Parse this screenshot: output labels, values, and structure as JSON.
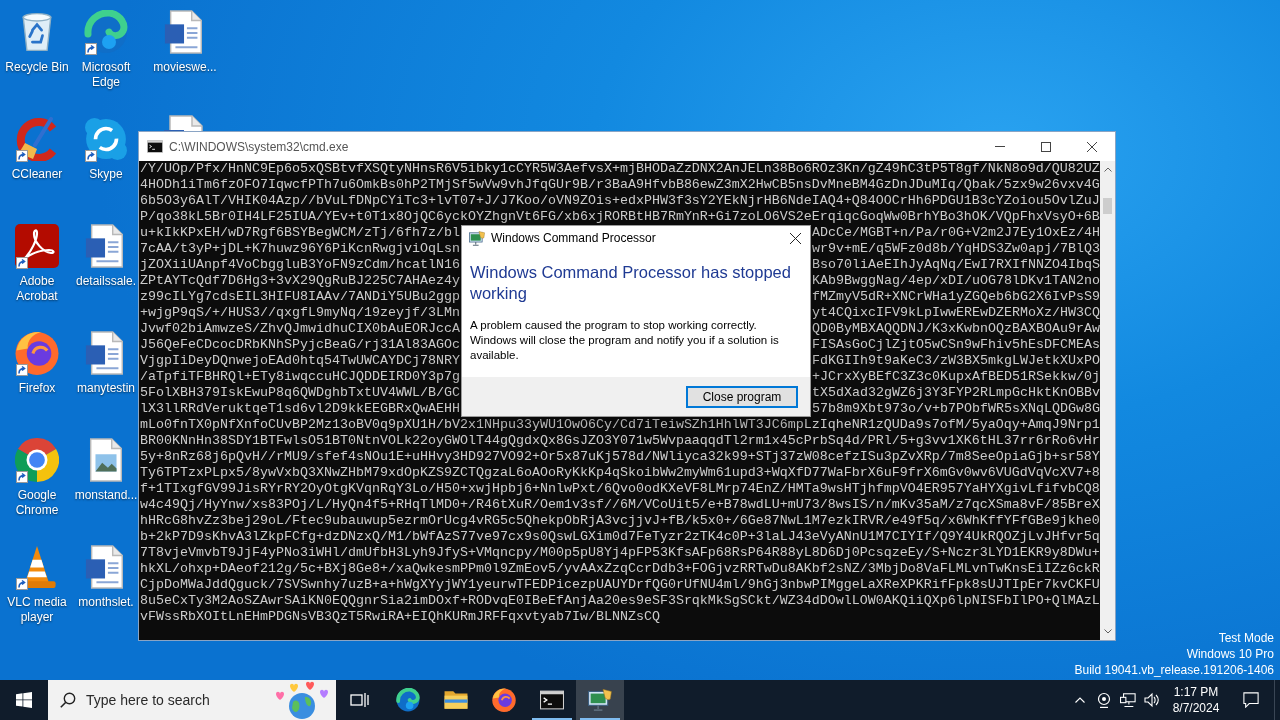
{
  "desktop": {
    "icon_columns": [
      {
        "icons": [
          {
            "label": "Recycle Bin",
            "kind": "recycle-bin",
            "shortcut": false
          },
          {
            "label": "CCleaner",
            "kind": "ring-brush",
            "shortcut": true
          },
          {
            "label": "Adobe Acrobat",
            "kind": "tile-logo",
            "shortcut": true
          },
          {
            "label": "Firefox",
            "kind": "fox-globe",
            "shortcut": true
          },
          {
            "label": "Google Chrome",
            "kind": "segmented-ring",
            "shortcut": true
          },
          {
            "label": "VLC media player",
            "kind": "cone",
            "shortcut": true
          }
        ]
      },
      {
        "icons": [
          {
            "label": "Microsoft Edge",
            "kind": "swirl",
            "shortcut": true
          },
          {
            "label": "Skype",
            "kind": "circle-logo",
            "shortcut": true
          },
          {
            "label": "detailssale.",
            "kind": "document",
            "shortcut": false
          },
          {
            "label": "manytestin",
            "kind": "document",
            "shortcut": false
          },
          {
            "label": "monstand...",
            "kind": "image-file",
            "shortcut": false
          },
          {
            "label": "monthslet.",
            "kind": "document",
            "shortcut": false
          }
        ]
      },
      {
        "icons": [
          {
            "label": "movieswe...",
            "kind": "document",
            "shortcut": false
          },
          {
            "kind": "document",
            "shortcut": false
          }
        ]
      }
    ],
    "system_info": [
      "Test Mode",
      "Windows 10 Pro",
      "Build 19041.vb_release.191206-1406"
    ]
  },
  "console_window": {
    "title": "C:\\WINDOWS\\system32\\cmd.exe",
    "lines": [
      {
        "kind": "full",
        "text": "/Y/UOp/Pfx/HnNC9Ep6o5xQSBtvfXSQtyNHnsR6V5ibky1cCYR5W3AefvsX+mjBHODaZzDNX2AnJELn38Bo6ROz3Kn/gZ49hC3tP5T8gf/NkN8o9d/QU82UZ"
      },
      {
        "kind": "full",
        "text": "4HODh1iTm6fzOFO7IqwcfPTh7u6OmkBs0hP2TMjSf5wVw9vhJfqGUr9B/r3BaA9HfvbB86ewZ3mX2HwCB5nsDvMneBM4GzDnJDuMIq/Qbak/5zx9w26vxv4G"
      },
      {
        "kind": "full",
        "text": "6b5O3y6AlT/VHIK04Azp//bVuLfDNpCYiTc3+lvT07+J/J7Koo/oVN9ZOis+edxPHW3f3sY2YEkNjrHB6NdeIAQ4+Q84OOCrHh6PDGU1B3cYZoiou5OvlZuJ"
      },
      {
        "kind": "full",
        "text": "P/qo38kL5Br0IH4LF25IUA/YEv+t0T1x8OjQC6yckOYZhgnVt6FG/xb6xjRORBtHB7RmYnR+Gi7zoLO6VS2eErqiqcGoqWw0BrhYBo3hOK/VQpFhxVsyO+6B"
      },
      {
        "kind": "split",
        "left": "u+kIkKPxEH/wD7Rgf6BSYBegWCM/zTj/6fh7z/bl",
        "right": "ADcCe/MGBT+n/Pa/r0G+V2m2J7Ey1OxEz/4H"
      },
      {
        "kind": "split",
        "left": "7cAA/t3yP+jDL+K7huwz96Y6PiKcnRwgjviOqLsn",
        "right": "wr9v+mE/q5WFz0d8b/YqHDS3Zw0apj/7BlQ3"
      },
      {
        "kind": "split",
        "left": "jZOXiiUAnpf4VoCbggluB3YoFN9zCdm/hcatlN16",
        "right": "Bso70liAeEIhJyAqNq/EwI7RXIfNNZO4IbqS"
      },
      {
        "kind": "split",
        "left": "ZPtAYTcQdf7D6Hg3+3vX29QgRuBJ225C7AHAez4y",
        "right": "KAb9BwggNag/4ep/xDI/uOG78lDKv1TAN2no"
      },
      {
        "kind": "split",
        "left": "z99cILYg7cdsEIL3HIFU8IAAv/7ANDiY5UBu2ggp",
        "right": "fMZmyV5dR+XNCrWHa1yZGQeb6bG2X6IvPsS9"
      },
      {
        "kind": "split",
        "left": "+wjgP9qS/+/HUS3//qxgfL9myNq/19zeyjf/3LMn",
        "right": "yt4CQixcIFV9kLpIwwEREwDZERMoXz/HW3CQ"
      },
      {
        "kind": "split",
        "left": "Jvwf02biAmwzeS/ZhvQJmwidhuCIX0bAuEORJccA",
        "right": "QD0ByMBXAQQDNJ/K3xKwbnOQzBAXBOAu9rAw"
      },
      {
        "kind": "split",
        "left": "J56QeFeCDcocDRbKNhSPyjcBeaG/rj31Al83AGOc",
        "right": "FISAsGoCjlZjtO5wCSn9wFhiv5hEsDFCMEAs"
      },
      {
        "kind": "split",
        "left": "VjgpIiDeyDQnwejoEAd0htq54TwUWCAYDCj78NRY",
        "right": "FdKGIIh9t9aKeC3/zW3BX5mkgLWJetkXUxPO"
      },
      {
        "kind": "split",
        "left": "/aTpfiTFBHRQl+ETy8iwqccuHCJQDDEIRD0Y3p7g",
        "right": "+JCrxXyBEfC3Z3c0KupxAfBED51RSekkw/0j"
      },
      {
        "kind": "split",
        "left": "5FolXBH379IskEwuP8q6QWDghbTxtUV4WWL/B/GC",
        "right": "tX5dXad32gWZ6j3Y3FYP2RLmpGcHktKnOBBv"
      },
      {
        "kind": "split",
        "left": "lX3llRRdVeruktqeT1sd6vl2D9kkEEGBRxQwAEHH",
        "right": "57b8m9Xbt973o/v+b7PObfWR5sXNqLQDGw8G"
      },
      {
        "kind": "full",
        "text": "mLo0fnTX0pNfXnfoCUvBP2Mz13oBV0q9pXU1H/bV2x1NHpu33yWU1OwO6Cy/Cd7iTeiwSZh1HhlWT3JC6mpLzIqheNR1zQUDa9s7ofM/5yaOqy+AmqJ9Nrp1"
      },
      {
        "kind": "full",
        "text": "BR00KNnHn38SDY1BTFwlsO51BT0NtnVOLk22oyGWOlT44gQgdxQx8GsJZO3Y071w5WvpaaqqdTl2rm1x45cPrbSq4d/PRl/5+g3vv1XK6tHL37rr6rRo6vHr"
      },
      {
        "kind": "full",
        "text": "5y+8nRz68j6pQvH//rMU9/sfef4sNOu1E+uHHvy3HD927VO92+Or5x87uKj578d/NWliyca32k99+STj37zW08cefzISu3pZvXRp/7m8SeeOpiaGjb+sr58Y"
      },
      {
        "kind": "full",
        "text": "Ty6TPTzxPLpx5/8ywVxbQ3XNwZHbM79xdOpKZS9ZCTQgzaL6oAOoRyKkKp4qSkoibWw2myWm61upd3+WqXfD77WaFbrX6uF9frX6mGv0wv6VUGdVqVcXV7+8"
      },
      {
        "kind": "full",
        "text": "f+1TIxgfGV99JisRYrRY2OyOtgKVqnRqY3Lo/H50+xwjHpbj6+NnlwPxt/6Qvo0odKXeVF8LMrp74EnZ/HMTa9wsHTjhfmpVO4ER957YaHYXgivLfifvbCQ8"
      },
      {
        "kind": "full",
        "text": "w4c49Qj/HyYnw/xs83POj/L/HyQn4f5+RHqTlMD0+/R46tXuR/Oem1v3sf//6M/VCoUit5/e+B78wdLU+mU73/8wsIS/n/mKv35aM/z7qcXSma8vF/85BreX"
      },
      {
        "kind": "full",
        "text": "hHRcG8hvZz3bej29oL/Ftec9ubauwup5ezrmOrUcg4vRG5c5QhekpObRjA3vcjjvJ+fB/k5x0+/6Ge87NwL1M7ezkIRVR/e49f5q/x6WhKffYFfGBe9jkhe0"
      },
      {
        "kind": "full",
        "text": "b+2kP7D9sKhvA3lZkpFCfg+dzDNzxQ/M1/bWfAzS77ve97cx9s0QswLGXim0d7FeTyzr2zTK4c0P+3laLJ43eVyANnU1M7CIYIf/Q9Y4UkRQOZjLvJHfvr5q"
      },
      {
        "kind": "full",
        "text": "7T8vjeVmvbT9JjF4yPNo3iWHl/dmUfbH3Lyh9JfyS+VMqncpy/M00p5pU8Yj4pFP53KfsAFp68RsP64R88yL8D6Dj0PcsqzeEy/S+Nczr3LYD1EKR9y8DWu+"
      },
      {
        "kind": "full",
        "text": "hkXL/ohxp+DAeof212g/5c+BXj8Ge8+/xaQwkesmPPm0l9ZmEov5/yvAAxZzqCcrDdb3+FOGjvzRRTwDu8AKbf2sNZ/3MbjDo8VaFLMLvnTwKnsEiIZz6ckR"
      },
      {
        "kind": "full",
        "text": "CjpDoMWaJddQguck/7SVSwnhy7uzB+a+hWgXYyjWY1yeurwTFEDPicezpUAUYDrfQG0rUfNU4ml/9hGj3nbwPIMggeLaXReXPKRifFpk8sUJTIpEr7kvCKFU"
      },
      {
        "kind": "full",
        "text": "8u5eCxTy3M2AoSZAwrSAiKN0EQQgnrSia2imDOxf+RODvqE0IBeEfAnjAa20es9eSF3SrqkMkSgSCkt/WZ34dDOwlLOW0AKQiiQXp6lpNISFbIlPO+QlMAzL"
      },
      {
        "kind": "full",
        "text": "vFWssRbXOItLnEHmPDGNsVB3QzT5RwiRA+EIQhKURmJRFFqxvtyab7Iw/BLNNZsCQ"
      }
    ]
  },
  "error_dialog": {
    "title": "Windows Command Processor",
    "heading": "Windows Command Processor has stopped working",
    "message": "A problem caused the program to stop working correctly. Windows will close the program and notify you if a solution is available.",
    "buttons": [
      {
        "label": "Close program",
        "focused": true
      }
    ]
  },
  "taskbar": {
    "search": {
      "placeholder": "Type here to search"
    },
    "apps": [
      {
        "kind": "swirl",
        "running": false,
        "active": false
      },
      {
        "kind": "folder",
        "running": false,
        "active": false
      },
      {
        "kind": "fox-globe",
        "running": false,
        "active": false
      },
      {
        "kind": "terminal",
        "running": true,
        "active": false
      },
      {
        "kind": "monitor",
        "running": true,
        "active": true
      }
    ],
    "clock": {
      "time": "1:17 PM",
      "date": "8/7/2024"
    }
  }
}
